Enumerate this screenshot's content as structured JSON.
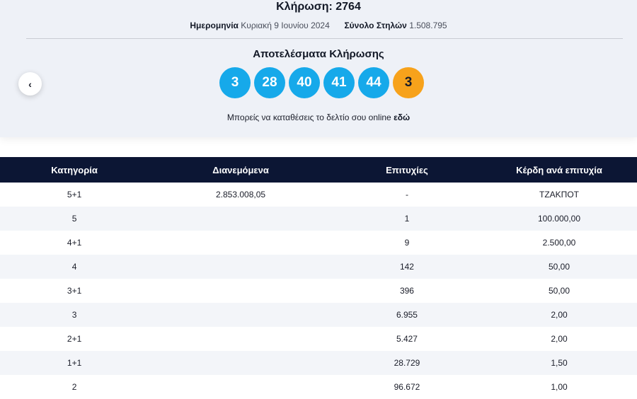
{
  "header": {
    "draw_title": "Κλήρωση: 2764",
    "date_label": "Ημερομηνία",
    "date_value": "Κυριακή 9 Ιουνίου 2024",
    "columns_label": "Σύνολο Στηλών",
    "columns_value": "1.508.795"
  },
  "results": {
    "title": "Αποτελέσματα Κλήρωσης",
    "numbers": [
      "3",
      "28",
      "40",
      "41",
      "44"
    ],
    "joker": "3",
    "online_text": "Μπορείς να καταθέσεις το δελτίο σου online",
    "online_link": "εδώ",
    "joker_color": "#f7a21b",
    "ball_color": "#16a9ea"
  },
  "nav": {
    "back_icon": "chevron-left-icon",
    "back_glyph": "‹"
  },
  "table": {
    "headers": [
      "Κατηγορία",
      "Διανεμόμενα",
      "Επιτυχίες",
      "Κέρδη ανά επιτυχία"
    ],
    "header_color": "#0c1634",
    "rows": [
      [
        "5+1",
        "2.853.008,05",
        "-",
        "ΤΖΑΚΠΟΤ"
      ],
      [
        "5",
        "",
        "1",
        "100.000,00"
      ],
      [
        "4+1",
        "",
        "9",
        "2.500,00"
      ],
      [
        "4",
        "",
        "142",
        "50,00"
      ],
      [
        "3+1",
        "",
        "396",
        "50,00"
      ],
      [
        "3",
        "",
        "6.955",
        "2,00"
      ],
      [
        "2+1",
        "",
        "5.427",
        "2,00"
      ],
      [
        "1+1",
        "",
        "28.729",
        "1,50"
      ],
      [
        "2",
        "",
        "96.672",
        "1,00"
      ]
    ]
  }
}
